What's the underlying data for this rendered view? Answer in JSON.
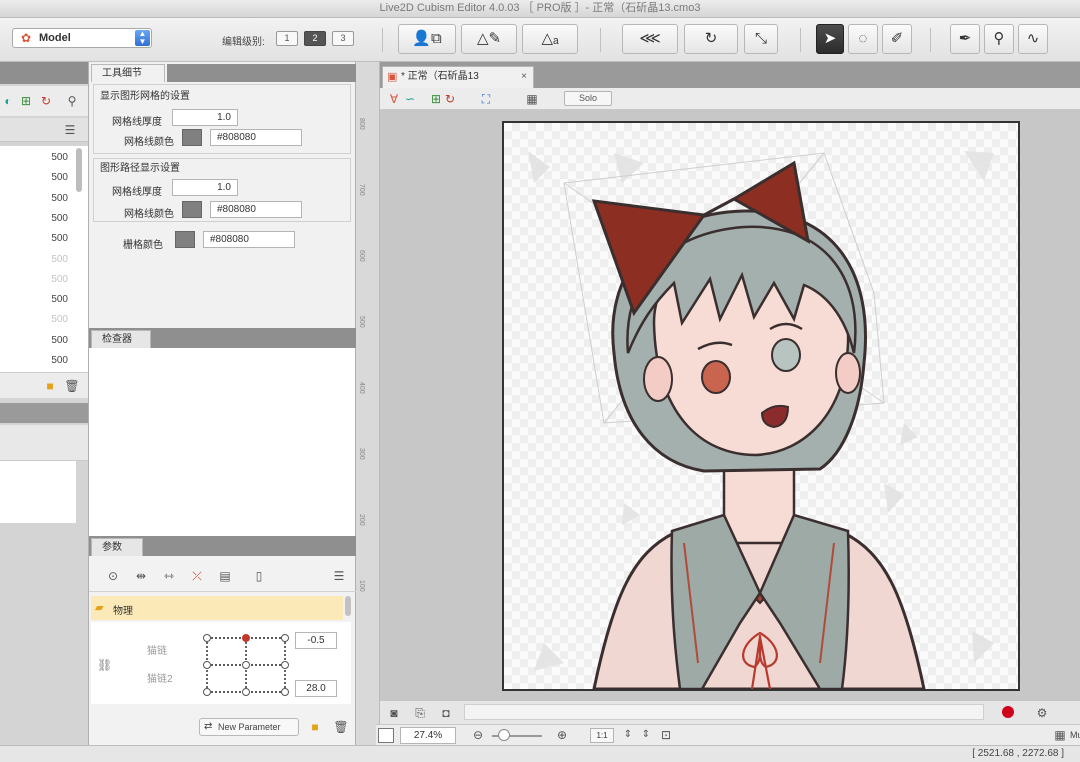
{
  "window": {
    "title": "Live2D Cubism Editor 4.0.03 ［ PRO版 ］- 正常（石斫晶13.cmo3"
  },
  "toolbar": {
    "mode_value": "Model",
    "edit_level_label": "编辑级别:",
    "edit_levels": [
      "1",
      "2",
      "3"
    ],
    "active_level": "2"
  },
  "left_list": {
    "values": [
      "500",
      "500",
      "500",
      "500",
      "500",
      "500",
      "500",
      "500",
      "500",
      "500",
      "500"
    ],
    "dim_rows": [
      5,
      6,
      8
    ]
  },
  "tool_details": {
    "tab": "工具细节",
    "mesh_group_title": "显示图形网格的设置",
    "mesh_thickness_label": "网格线厚度",
    "mesh_thickness_value": "1.0",
    "mesh_color_label": "网格线颜色",
    "mesh_color_value": "#808080",
    "path_group_title": "图形路径显示设置",
    "path_thickness_label": "网格线厚度",
    "path_thickness_value": "1.0",
    "path_color_label": "网格线颜色",
    "path_color_value": "#808080",
    "grid_color_label": "栅格颜色",
    "grid_color_value": "#808080"
  },
  "inspector": {
    "tab": "检查器"
  },
  "params": {
    "tab": "参数",
    "folder": "物理",
    "param1_label": "猫链",
    "param1_value": "-0.5",
    "param2_label": "猫链2",
    "param2_value": "28.0",
    "new_param_label": "New Parameter"
  },
  "view": {
    "tab_title": "* 正常（石斫晶13",
    "solo_label": "Solo",
    "zoom": "27.4%",
    "ratio": "1:1",
    "coords": "[ 2521.68 , 2272.68 ]",
    "right_cut": "Mu"
  },
  "ruler": {
    "labels": [
      "800",
      "700",
      "600",
      "500",
      "400",
      "300",
      "200",
      "100"
    ]
  },
  "colors": {
    "accent": "#2f6fd6",
    "record": "#d0021b",
    "folder_bg": "#fbe9b7"
  }
}
